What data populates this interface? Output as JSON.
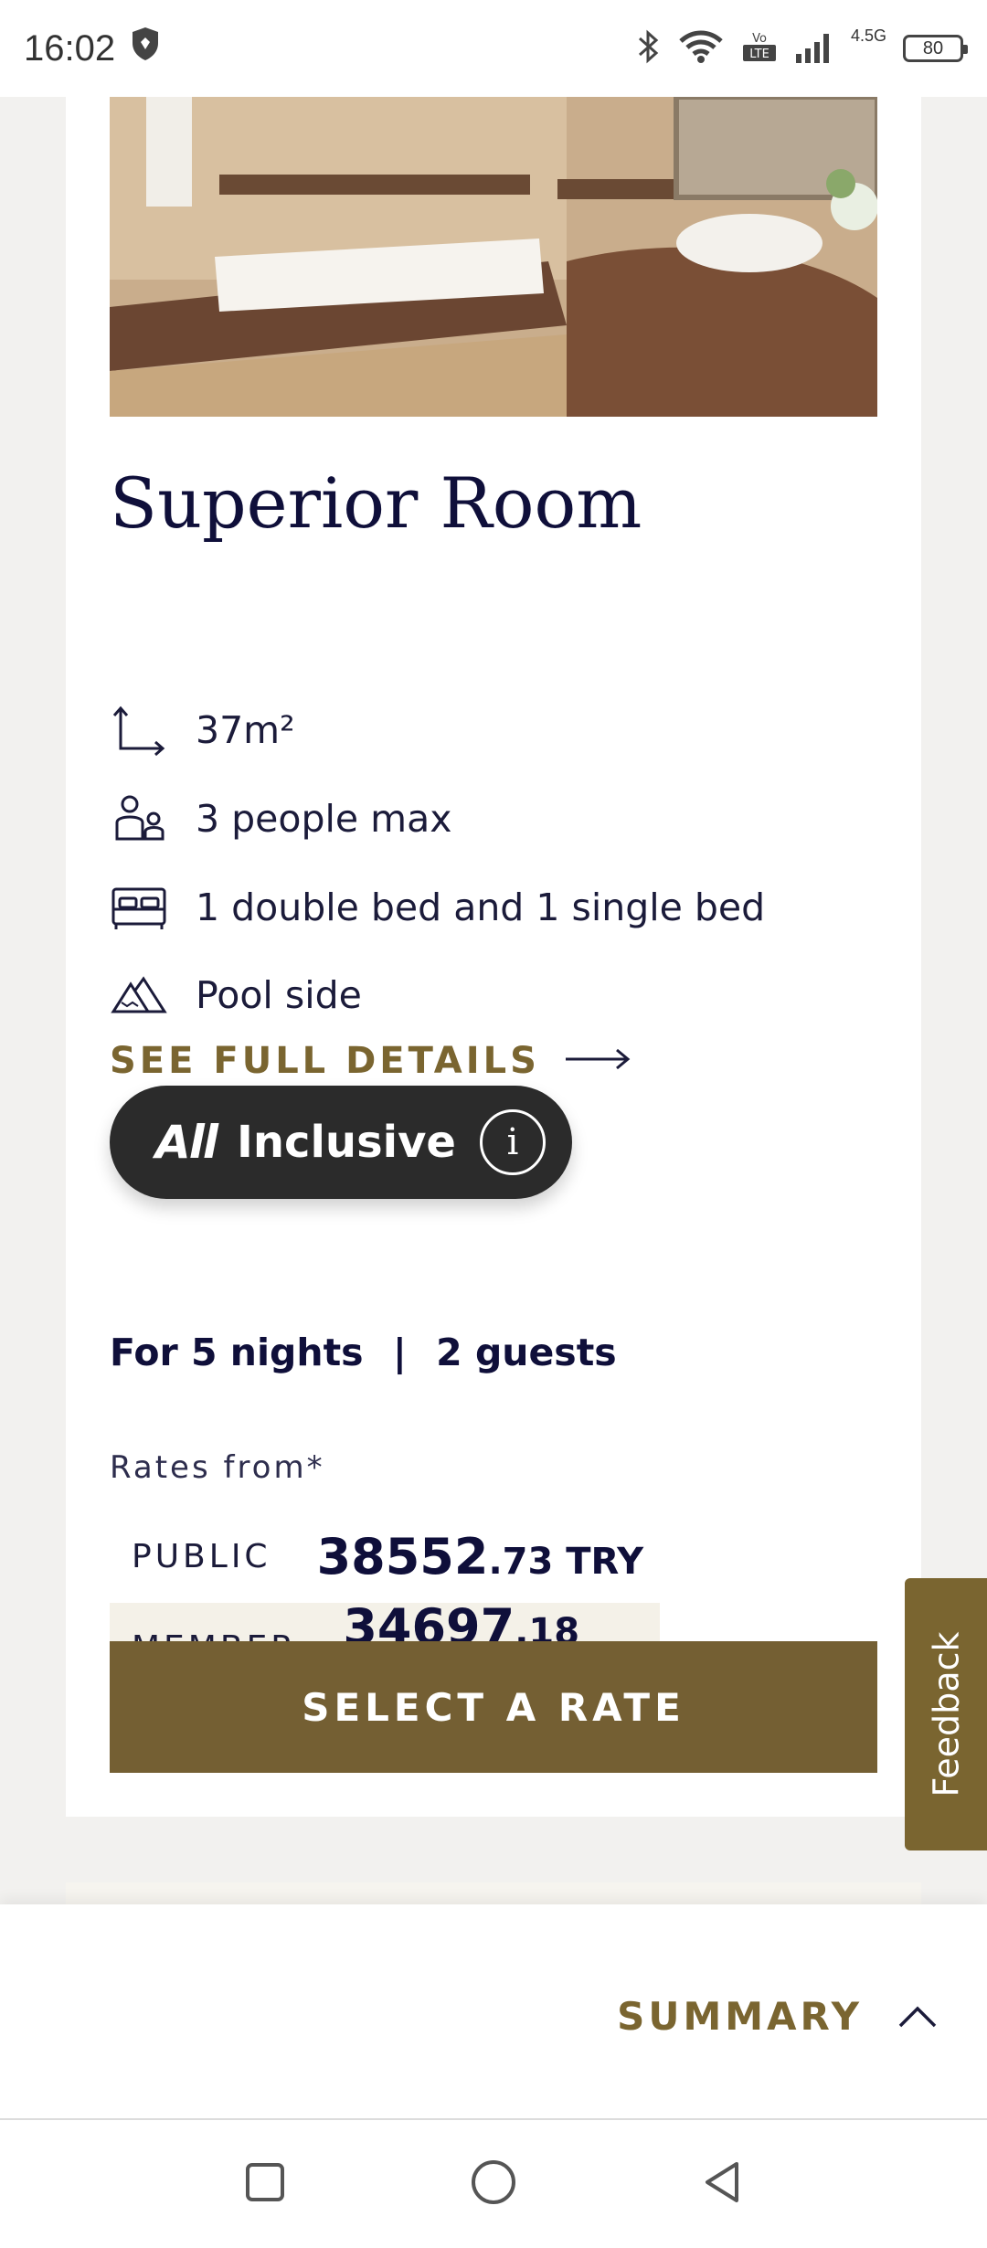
{
  "status_bar": {
    "time": "16:02",
    "network": "4.5G",
    "volte": "Vo LTE",
    "battery": "80"
  },
  "room": {
    "title": "Superior Room",
    "features": [
      {
        "icon": "area-icon",
        "text": "37m²"
      },
      {
        "icon": "people-icon",
        "text": "3 people max"
      },
      {
        "icon": "bed-icon",
        "text": "1 double bed and 1 single bed"
      },
      {
        "icon": "mountain-view-icon",
        "text": "Pool side"
      }
    ],
    "details_link": "SEE FULL DETAILS"
  },
  "offer": {
    "logo": "All",
    "label": "Inclusive",
    "info_glyph": "i"
  },
  "stay": {
    "nights": "For 5 nights",
    "separator": "|",
    "guests": "2 guests"
  },
  "rates": {
    "heading": "Rates from*",
    "public": {
      "label": "PUBLIC",
      "whole": "38552",
      "decimal": ".73 TRY"
    },
    "member": {
      "label": "MEMBER",
      "whole": "34697",
      "decimal": ".18 TRY"
    }
  },
  "select_button": "SELECT A RATE",
  "feedback": "Feedback",
  "summary": "SUMMARY",
  "colors": {
    "accent_gold": "#745f33",
    "navy_text": "#0f0f3a",
    "pill_dark": "#2b2b2b",
    "member_bg": "#f4f1e8"
  }
}
